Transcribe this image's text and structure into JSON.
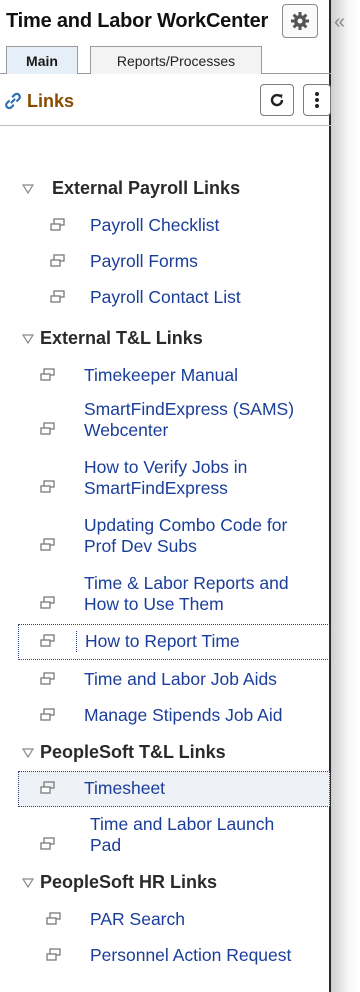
{
  "workcenter": {
    "title": "Time and Labor WorkCenter",
    "tabs": [
      {
        "label": "Main",
        "active": true
      },
      {
        "label": "Reports/Processes",
        "active": false
      }
    ]
  },
  "links_pagelet": {
    "title": "Links",
    "groups": [
      {
        "label": "External Payroll Links",
        "links": [
          {
            "label": "Payroll Checklist"
          },
          {
            "label": "Payroll Forms"
          },
          {
            "label": "Payroll Contact List"
          }
        ]
      },
      {
        "label": "External T&L Links",
        "links": [
          {
            "label": "Timekeeper Manual"
          },
          {
            "label": "SmartFindExpress (SAMS) Webcenter"
          },
          {
            "label": "How to Verify Jobs in SmartFindExpress"
          },
          {
            "label": "Updating Combo Code for Prof Dev Subs"
          },
          {
            "label": "Time & Labor Reports and How to Use Them"
          },
          {
            "label": "How to Report Time"
          },
          {
            "label": "Time and Labor Job Aids"
          },
          {
            "label": "Manage Stipends Job Aid"
          }
        ]
      },
      {
        "label": "PeopleSoft T&L Links",
        "links": [
          {
            "label": "Timesheet"
          },
          {
            "label": "Time and Labor Launch Pad"
          }
        ]
      },
      {
        "label": "PeopleSoft HR Links",
        "links": [
          {
            "label": "PAR Search"
          },
          {
            "label": "Personnel Action Request"
          }
        ]
      }
    ]
  },
  "colors": {
    "link": "#1a3e9a",
    "links_title": "#8a4b00",
    "group_label": "#2a2a2a"
  }
}
